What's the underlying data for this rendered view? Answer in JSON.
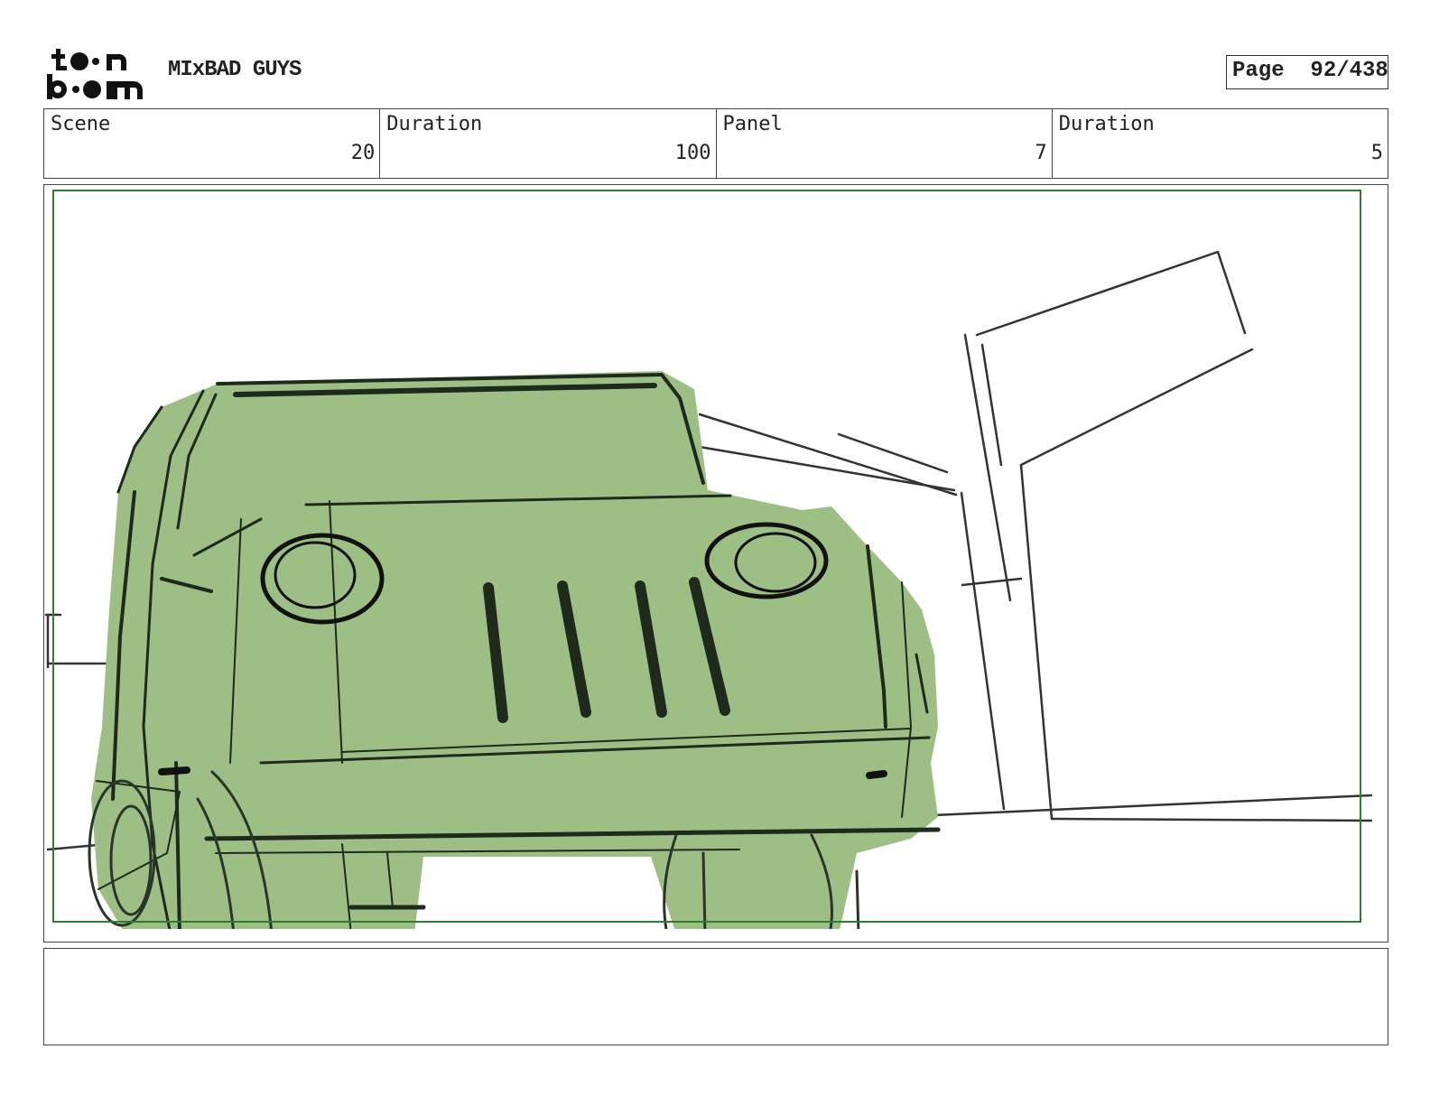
{
  "header": {
    "logo_text": "toon boom",
    "project_title": "MIxBAD GUYS",
    "page_label": "Page",
    "page_value": "92/438"
  },
  "info": [
    {
      "label": "Scene",
      "value": "20"
    },
    {
      "label": "Duration",
      "value": "100"
    },
    {
      "label": "Panel",
      "value": "7"
    },
    {
      "label": "Duration",
      "value": "5"
    }
  ],
  "colors": {
    "safe_frame": "#2e7d32",
    "vehicle_fill": "#9dbf86",
    "line": "#1e2a1c"
  },
  "panel": {
    "subject": "green truck sketch"
  },
  "notes": {
    "text": ""
  }
}
